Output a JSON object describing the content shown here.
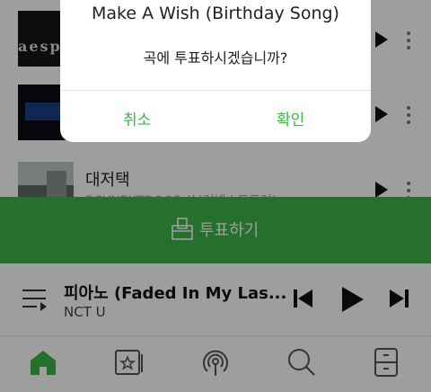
{
  "list": {
    "rows": [
      {
        "thumb_text": "aespa"
      },
      {
        "thumb_text": ""
      },
      {
        "title": "대저택",
        "artist": "BOYNEXTDOOR (보이넥스트도어)"
      }
    ]
  },
  "vote": {
    "label": "투표하기"
  },
  "player": {
    "title": "피아노 (Faded In My Las...",
    "artist": "NCT U"
  },
  "dialog": {
    "title": "Make A Wish (Birthday Song)",
    "message": "곡에 투표하시겠습니까?",
    "cancel": "취소",
    "confirm": "확인"
  },
  "colors": {
    "accent": "#3db547",
    "overlay": "rgba(0,0,0,0.38)"
  },
  "icons": [
    "home-icon",
    "music-star-icon",
    "podcast-icon",
    "search-icon",
    "drawer-icon",
    "playlist-icon",
    "previous-icon",
    "play-icon",
    "next-icon",
    "vote-box-icon",
    "more-icon"
  ]
}
